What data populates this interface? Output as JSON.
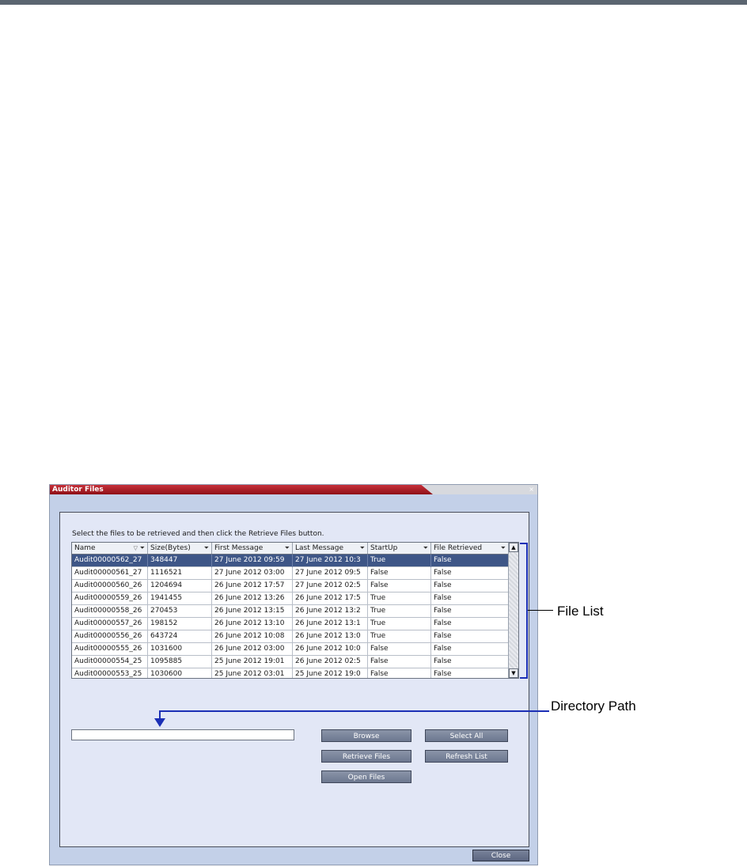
{
  "dialog": {
    "title": "Auditor Files",
    "close_glyph": "×",
    "instruction": "Select the files to be retrieved and then click the Retrieve Files button."
  },
  "grid": {
    "columns": [
      {
        "label": "Name",
        "sort_icon": "sort-icon",
        "filter_icon": "filter-icon"
      },
      {
        "label": "Size(Bytes)",
        "filter_icon": "filter-icon"
      },
      {
        "label": "First Message",
        "filter_icon": "filter-icon"
      },
      {
        "label": "Last Message",
        "filter_icon": "filter-icon"
      },
      {
        "label": "StartUp",
        "filter_icon": "filter-icon"
      },
      {
        "label": "File Retrieved",
        "filter_icon": "filter-icon"
      }
    ],
    "rows": [
      [
        "Audit00000562_27",
        "348447",
        "27 June 2012 09:59",
        "27 June 2012 10:3",
        "True",
        "False"
      ],
      [
        "Audit00000561_27",
        "1116521",
        "27 June 2012 03:00",
        "27 June 2012 09:5",
        "False",
        "False"
      ],
      [
        "Audit00000560_26",
        "1204694",
        "26 June 2012 17:57",
        "27 June 2012 02:5",
        "False",
        "False"
      ],
      [
        "Audit00000559_26",
        "1941455",
        "26 June 2012 13:26",
        "26 June 2012 17:5",
        "True",
        "False"
      ],
      [
        "Audit00000558_26",
        "270453",
        "26 June 2012 13:15",
        "26 June 2012 13:2",
        "True",
        "False"
      ],
      [
        "Audit00000557_26",
        "198152",
        "26 June 2012 13:10",
        "26 June 2012 13:1",
        "True",
        "False"
      ],
      [
        "Audit00000556_26",
        "643724",
        "26 June 2012 10:08",
        "26 June 2012 13:0",
        "True",
        "False"
      ],
      [
        "Audit00000555_26",
        "1031600",
        "26 June 2012 03:00",
        "26 June 2012 10:0",
        "False",
        "False"
      ],
      [
        "Audit00000554_25",
        "1095885",
        "25 June 2012 19:01",
        "26 June 2012 02:5",
        "False",
        "False"
      ],
      [
        "Audit00000553_25",
        "1030600",
        "25 June 2012 03:01",
        "25 June 2012 19:0",
        "False",
        "False"
      ]
    ],
    "selected_row": 0,
    "scroll_up_glyph": "▲",
    "scroll_down_glyph": "▼"
  },
  "directory_path": {
    "value": "",
    "placeholder": ""
  },
  "buttons": {
    "browse": "Browse",
    "select_all": "Select All",
    "retrieve_files": "Retrieve Files",
    "refresh_list": "Refresh List",
    "open_files": "Open Files",
    "close": "Close"
  },
  "annotations": {
    "file_list": "File List",
    "directory_path": "Directory Path"
  },
  "colors": {
    "annotation_blue": "#1b2fb5",
    "title_red": "#b0202a",
    "selected_row": "#3e5687"
  }
}
